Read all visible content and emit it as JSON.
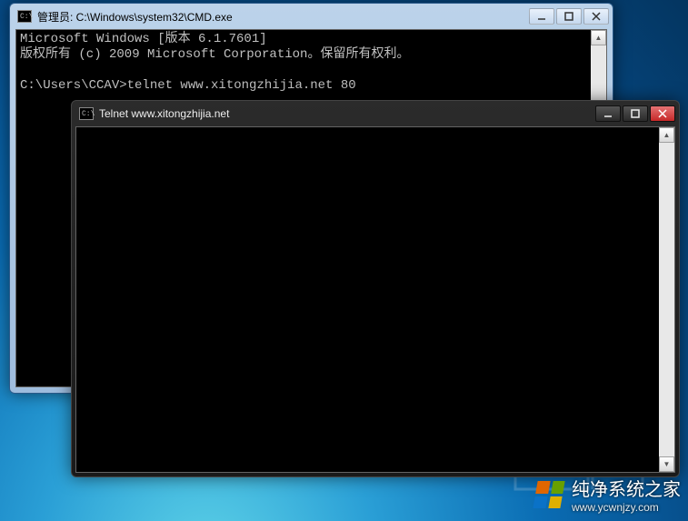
{
  "windows": {
    "cmd": {
      "title": "管理员: C:\\Windows\\system32\\CMD.exe",
      "lines": {
        "l1": "Microsoft Windows [版本 6.1.7601]",
        "l2": "版权所有 (c) 2009 Microsoft Corporation。保留所有权利。",
        "l3": "",
        "l4": "C:\\Users\\CCAV>telnet www.xitongzhijia.net 80"
      }
    },
    "telnet": {
      "title": "Telnet www.xitongzhijia.net"
    }
  },
  "icons": {
    "console": "C:\\"
  },
  "scrollbar": {
    "up": "▲",
    "down": "▼"
  },
  "watermark": {
    "text": "纯净系统之家",
    "url": "www.ycwnjzy.com"
  }
}
